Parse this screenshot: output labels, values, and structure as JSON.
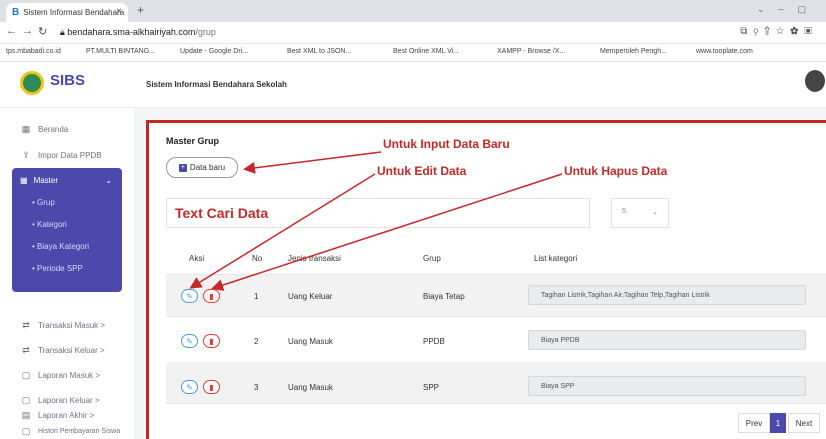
{
  "browser": {
    "tab_title": "Sistem Informasi Bendahara",
    "url_host": "bendahara.sma-alkhairiyah.com",
    "url_path": "/grup",
    "bookmarks": [
      "tps.mbabadi.co.id",
      "PT.MULTI BINTANG...",
      "Update - Google Dri...",
      "Best XML to JSON...",
      "Best Online XML Vi...",
      "XAMPP - Browse /X...",
      "Memperoleh Pengh...",
      "www.tooplate.com"
    ]
  },
  "header": {
    "brand": "SIBS",
    "app_title": "Sistem Informasi Bendahara Sekolah"
  },
  "sidebar": {
    "items": [
      {
        "label": "Beranda",
        "icon": "grid"
      },
      {
        "label": "Impor Data PPDB",
        "icon": "upload"
      },
      {
        "label": "Transaksi Masuk >",
        "icon": "exchange"
      },
      {
        "label": "Transaksi Keluar >",
        "icon": "exchange"
      },
      {
        "label": "Laporan Masuk >",
        "icon": "document"
      },
      {
        "label": "Laporan Keluar >",
        "icon": "document"
      },
      {
        "label": "Laporan Akhir >",
        "icon": "report"
      },
      {
        "label": "Histori Pembayaran Siswa",
        "icon": "document"
      }
    ],
    "master": {
      "label": "Master",
      "children": [
        "Grup",
        "Kategori",
        "Biaya Kategori",
        "Periode SPP"
      ]
    }
  },
  "main": {
    "title": "Master Grup",
    "new_button": "Data baru",
    "search_text": "Text Cari Data",
    "per_page": "5",
    "columns": [
      "Aksi",
      "No",
      "Jenis transaksi",
      "Grup",
      "List kategori"
    ],
    "rows": [
      {
        "no": "1",
        "jenis": "Uang Keluar",
        "grup": "Biaya Tetap",
        "kategori": "Tagihan Listrik,Tagihan Air,Tagihan Telp,Tagihan Listrik"
      },
      {
        "no": "2",
        "jenis": "Uang Masuk",
        "grup": "PPDB",
        "kategori": "Biaya PPDB"
      },
      {
        "no": "3",
        "jenis": "Uang Masuk",
        "grup": "SPP",
        "kategori": "Biaya SPP"
      }
    ],
    "pagination": {
      "prev": "Prev",
      "current": "1",
      "next": "Next"
    }
  },
  "annotations": {
    "input": "Untuk Input Data Baru",
    "edit": "Untuk Edit Data",
    "delete": "Untuk Hapus Data"
  },
  "colors": {
    "accent": "#4b49ac",
    "annotation": "#c62828",
    "edit": "#4a9be4",
    "delete": "#e53935"
  }
}
